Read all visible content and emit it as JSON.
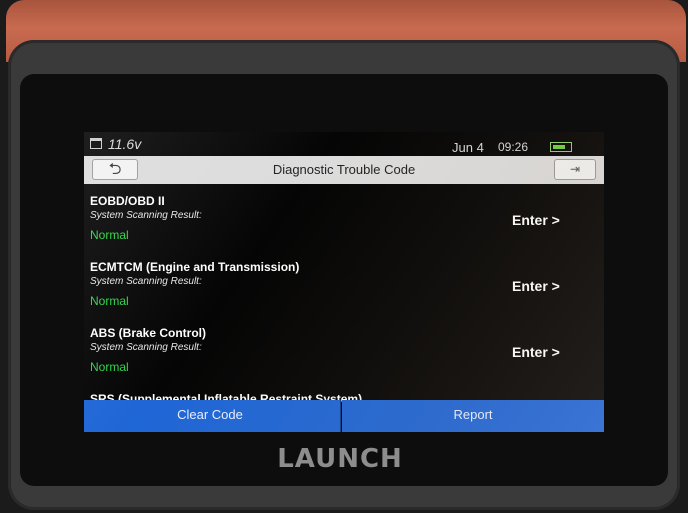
{
  "status_bar": {
    "voltage": "11.6v",
    "date": "Jun 4",
    "time": "09:26"
  },
  "header": {
    "title": "Diagnostic Trouble Code",
    "back_glyph": "⮌",
    "exit_glyph": "⇥"
  },
  "systems": [
    {
      "name": "EOBD/OBD II",
      "label": "System Scanning Result:",
      "result": "Normal",
      "action": "Enter >"
    },
    {
      "name": "ECMTCM (Engine and Transmission)",
      "label": "System Scanning Result:",
      "result": "Normal",
      "action": "Enter >"
    },
    {
      "name": "ABS (Brake Control)",
      "label": "System Scanning Result:",
      "result": "Normal",
      "action": "Enter >"
    },
    {
      "name": "SRS (Supplemental Inflatable Restraint System)"
    }
  ],
  "buttons": {
    "clear": "Clear Code",
    "report": "Report"
  },
  "device": {
    "brand": "LAUNCH"
  },
  "colors": {
    "normal": "#2fd24a",
    "button": "#1f66d6",
    "battery": "#6cd23c"
  }
}
